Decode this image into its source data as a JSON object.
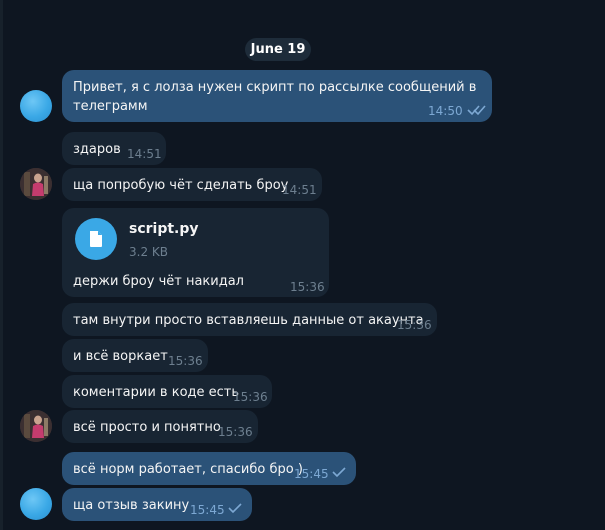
{
  "date_label": "June 19",
  "messages": [
    {
      "text": "Привет, я с лолза нужен скрипт по рассылке сообщений в",
      "text2": "телеграмм",
      "time": "14:50"
    },
    {
      "text": "здаров",
      "time": "14:51"
    },
    {
      "text": "ща попробую чёт сделать броу",
      "time": "14:51"
    },
    {
      "file_name": "script.py",
      "file_size": "3.2 KB",
      "text": "держи броу чёт накидал",
      "time": "15:36"
    },
    {
      "text": "там внутри просто вставляешь данные от акаунта",
      "time": "15:36"
    },
    {
      "text": "и всё воркает",
      "time": "15:36"
    },
    {
      "text": "коментарии в коде есть",
      "time": "15:36"
    },
    {
      "text": "всё просто и понятно",
      "time": "15:36"
    },
    {
      "text": "всё норм работает, спасибо бро )",
      "time": "15:45"
    },
    {
      "text": "ща отзыв закину",
      "time": "15:45"
    }
  ],
  "colors": {
    "outgoing": "#2b5278",
    "incoming": "#182533",
    "background": "#0e1621",
    "accent": "#3aa8e6"
  }
}
